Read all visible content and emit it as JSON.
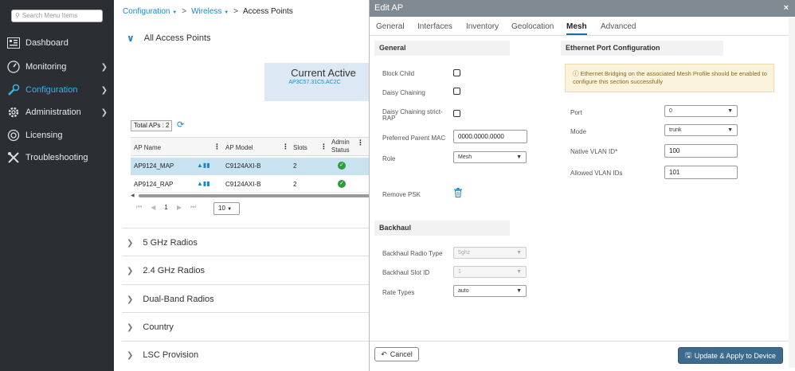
{
  "sidebar": {
    "search_placeholder": "Search Menu Items",
    "items": [
      {
        "label": "Dashboard",
        "icon": "dashboard-icon"
      },
      {
        "label": "Monitoring",
        "icon": "monitoring-icon"
      },
      {
        "label": "Configuration",
        "icon": "configuration-icon"
      },
      {
        "label": "Administration",
        "icon": "administration-icon"
      },
      {
        "label": "Licensing",
        "icon": "licensing-icon"
      },
      {
        "label": "Troubleshooting",
        "icon": "troubleshooting-icon"
      }
    ],
    "active_color": "#3ab2e6"
  },
  "breadcrumb": {
    "c1": "Configuration",
    "c2": "Wireless",
    "sep": ">",
    "current": "Access Points"
  },
  "main": {
    "all_aps": "All Access Points",
    "current_active": "Current Active",
    "active_ap": "AP3C57.31C5.AC2C",
    "total_aps": "Total APs : 2",
    "columns": {
      "name": "AP Name",
      "model": "AP Model",
      "slots": "Slots",
      "admin1": "Admin",
      "admin2": "Status"
    },
    "rows": [
      {
        "name": "AP9124_MAP",
        "model": "C9124AXI-B",
        "slots": "2"
      },
      {
        "name": "AP9124_RAP",
        "model": "C9124AXI-B",
        "slots": "2"
      }
    ],
    "page": "1",
    "per_page": "10",
    "sections": [
      "5 GHz Radios",
      "2.4 GHz Radios",
      "Dual-Band Radios",
      "Country",
      "LSC Provision"
    ]
  },
  "panel": {
    "title": "Edit AP",
    "close": "×",
    "tabs": [
      "General",
      "Interfaces",
      "Inventory",
      "Geolocation",
      "Mesh",
      "Advanced"
    ],
    "active_tab": "Mesh",
    "general": "General",
    "block_child": "Block Child",
    "daisy": "Daisy Chaining",
    "daisy_strict1": "Daisy Chaining strict-",
    "daisy_strict2": "RAP",
    "pref_parent": "Preferred Parent MAC",
    "pref_parent_val": "0000.0000.0000",
    "role": "Role",
    "role_val": "Mesh",
    "remove_psk": "Remove PSK",
    "backhaul": "Backhaul",
    "bh_radio": "Backhaul Radio Type",
    "bh_radio_val": "5ghz",
    "bh_slot": "Backhaul Slot ID",
    "bh_slot_val": "1",
    "rate": "Rate Types",
    "rate_val": "auto",
    "eth_title": "Ethernet Port Configuration",
    "note": "Ethernet Bridging on the associated Mesh Profile should be enabled to configure this section successfully",
    "port": "Port",
    "port_val": "0",
    "mode": "Mode",
    "mode_val": "trunk",
    "native_vlan": "Native VLAN ID*",
    "native_vlan_val": "100",
    "allowed_vlan": "Allowed VLAN IDs",
    "allowed_vlan_val": "101",
    "cancel": "Cancel",
    "update": "Update & Apply to Device"
  }
}
